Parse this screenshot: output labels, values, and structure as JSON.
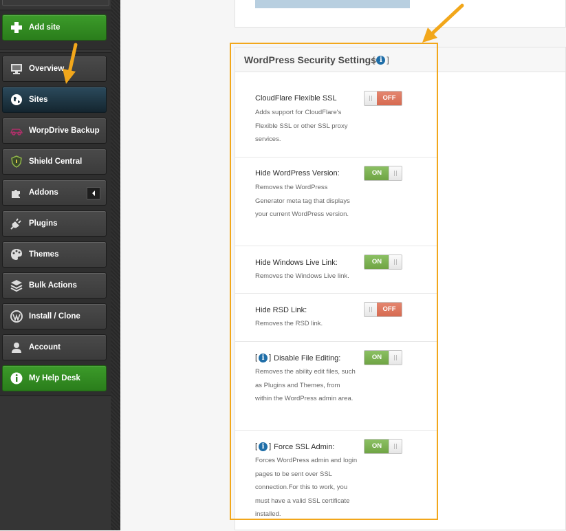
{
  "sidebar": {
    "add_site": "Add site",
    "items": [
      {
        "label": "Overview"
      },
      {
        "label": "Sites"
      },
      {
        "label": "WorpDrive Backup"
      },
      {
        "label": "Shield Central"
      },
      {
        "label": "Addons"
      },
      {
        "label": "Plugins"
      },
      {
        "label": "Themes"
      },
      {
        "label": "Bulk Actions"
      },
      {
        "label": "Install / Clone"
      },
      {
        "label": "Account"
      },
      {
        "label": "My Help Desk"
      }
    ]
  },
  "panel": {
    "title": "WordPress Security Settings",
    "settings": [
      {
        "title": "CloudFlare Flexible SSL",
        "description": "Adds support for CloudFlare's Flexible SSL or other SSL proxy services.",
        "state": "OFF"
      },
      {
        "title": "Hide WordPress Version:",
        "description": "Removes the WordPress Generator meta tag that displays your current WordPress version.",
        "state": "ON"
      },
      {
        "title": "Hide Windows Live Link:",
        "description": "Removes the Windows Live link.",
        "state": "ON"
      },
      {
        "title": "Hide RSD Link:",
        "description": "Removes the RSD link.",
        "state": "OFF"
      },
      {
        "title": "Disable File Editing:",
        "description": "Removes the ability edit files, such as Plugins and Themes, from within the WordPress admin area.",
        "state": "ON"
      },
      {
        "title": "Force SSL Admin:",
        "description": "Forces WordPress admin and login pages to be sent over SSL connection.For this to work, you must have a valid SSL certificate installed.",
        "state": "ON"
      }
    ]
  },
  "colors": {
    "sidebar_bg": "#353535",
    "green_button": "#2e8a1f",
    "active_item": "#1b3442",
    "toggle_on": "#7db155",
    "toggle_off": "#dd7660",
    "annotation": "#f2a71b",
    "info_icon": "#1f6ea8"
  }
}
